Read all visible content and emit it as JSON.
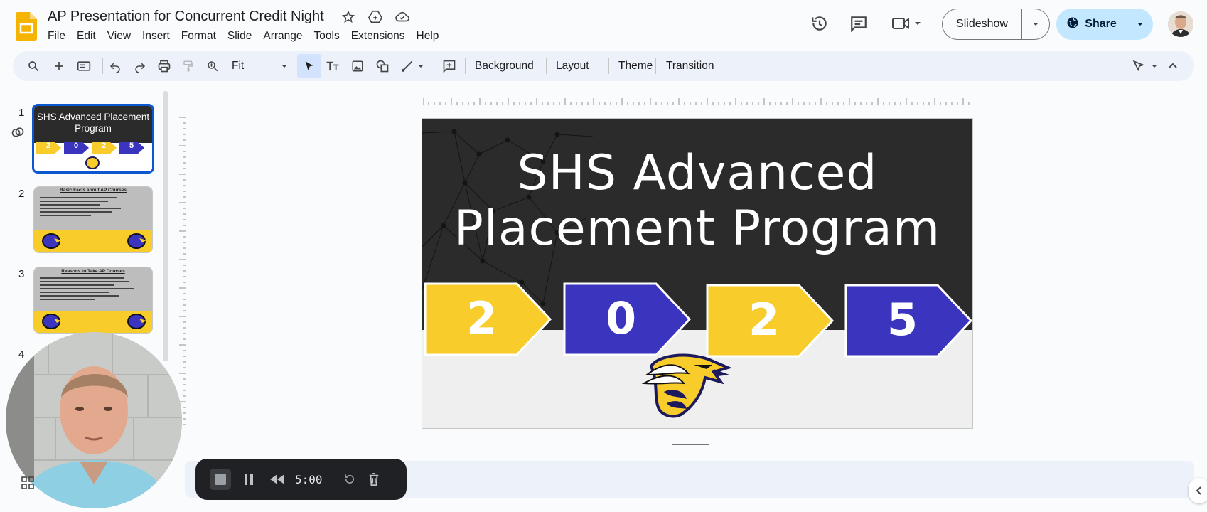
{
  "header": {
    "doc_title": "AP Presentation for Concurrent Credit Night",
    "menu": [
      "File",
      "Edit",
      "View",
      "Insert",
      "Format",
      "Slide",
      "Arrange",
      "Tools",
      "Extensions",
      "Help"
    ],
    "slideshow_label": "Slideshow",
    "share_label": "Share"
  },
  "toolbar": {
    "zoom_value": "Fit",
    "background_label": "Background",
    "layout_label": "Layout",
    "theme_label": "Theme",
    "transition_label": "Transition"
  },
  "filmstrip": {
    "slides": [
      {
        "number": "1",
        "title": "SHS Advanced Placement Program",
        "digits": [
          "2",
          "0",
          "2",
          "5"
        ]
      },
      {
        "number": "2",
        "title": "Basic Facts about AP Courses"
      },
      {
        "number": "3",
        "title": "Reasons to Take AP Courses"
      },
      {
        "number": "4"
      }
    ]
  },
  "slide": {
    "title_line1": "SHS Advanced",
    "title_line2": "Placement Program",
    "digits": [
      "2",
      "0",
      "2",
      "5"
    ]
  },
  "recorder": {
    "time": "5:00"
  },
  "colors": {
    "accent_blue": "#0b57d0",
    "share_bg": "#c2e7ff",
    "slide_dark": "#2b2b2b",
    "arrow_yellow": "#f7cc2b",
    "arrow_blue": "#3a34bf"
  }
}
